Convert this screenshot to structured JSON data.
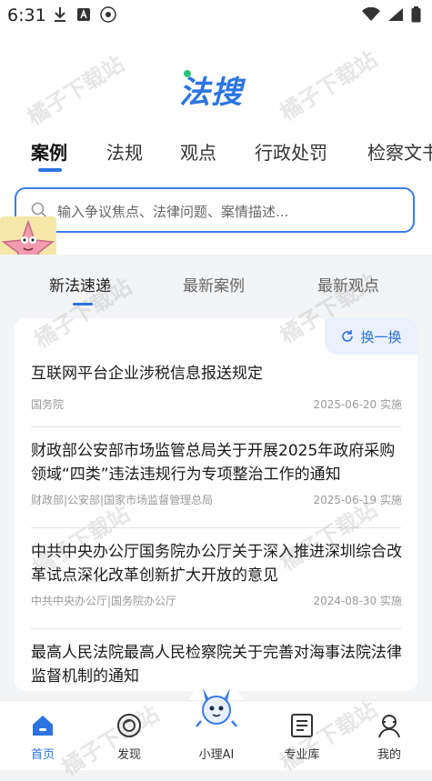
{
  "status": {
    "time": "6:31"
  },
  "app": {
    "logo": "法搜"
  },
  "category_tabs": [
    "案例",
    "法规",
    "观点",
    "行政处罚",
    "检察文书"
  ],
  "search": {
    "placeholder": "输入争议焦点、法律问题、案情描述..."
  },
  "news_tabs": [
    "新法速递",
    "最新案例",
    "最新观点"
  ],
  "refresh_label": "换一换",
  "articles": [
    {
      "title": "互联网平台企业涉税信息报送规定",
      "publisher": "国务院",
      "date": "2025-06-20 实施"
    },
    {
      "title": "财政部公安部市场监管总局关于开展2025年政府采购领域“四类”违法违规行为专项整治工作的通知",
      "publisher": "财政部|公安部|国家市场监督管理总局",
      "date": "2025-06-19 实施"
    },
    {
      "title": "中共中央办公厅国务院办公厅关于深入推进深圳综合改革试点深化改革创新扩大开放的意见",
      "publisher": "中共中央办公厅|国务院办公厅",
      "date": "2024-08-30 实施"
    },
    {
      "title": "最高人民法院最高人民检察院关于完善对海事法院法律监督机制的通知",
      "publisher": "",
      "date": ""
    }
  ],
  "bottom_nav": [
    {
      "label": "首页",
      "icon": "home-icon"
    },
    {
      "label": "发现",
      "icon": "discover-icon"
    },
    {
      "label": "小理AI",
      "icon": "ai-assistant-icon"
    },
    {
      "label": "专业库",
      "icon": "library-icon"
    },
    {
      "label": "我的",
      "icon": "profile-icon"
    }
  ],
  "watermark": "橘子下载站",
  "colors": {
    "accent": "#2b74e2",
    "logo_dot": "#2ec27e"
  }
}
